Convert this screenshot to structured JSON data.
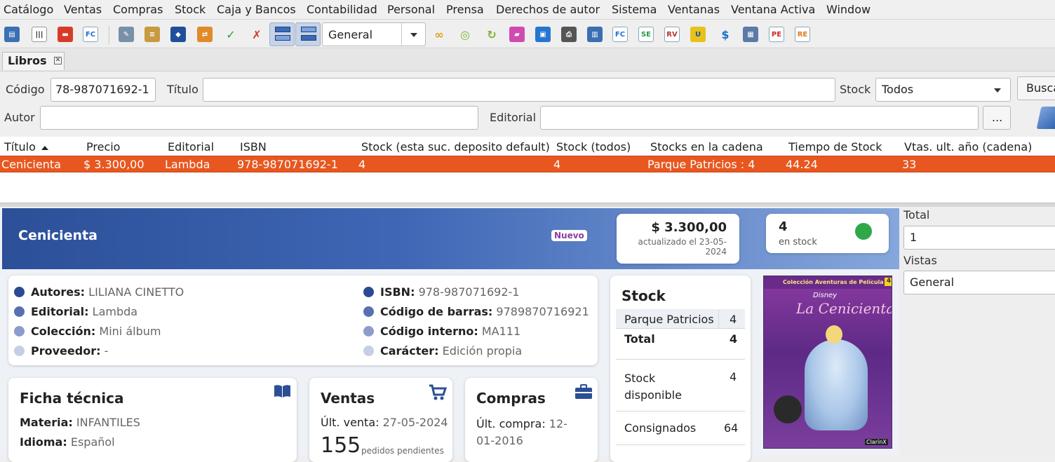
{
  "menu": [
    "Catálogo",
    "Ventas",
    "Compras",
    "Stock",
    "Caja y Bancos",
    "Contabilidad",
    "Personal",
    "Prensa",
    "Derechos de autor",
    "Sistema",
    "Ventanas",
    "Ventana Activa",
    "Window"
  ],
  "toolbar": {
    "view_select": "General"
  },
  "tab": {
    "label": "Libros"
  },
  "filters": {
    "codigo_label": "Código",
    "codigo_value": "78-987071692-1",
    "titulo_label": "Título",
    "titulo_value": "",
    "stock_label": "Stock",
    "stock_value": "Todos",
    "buscar_label": "Buscar",
    "autor_label": "Autor",
    "autor_value": "",
    "editorial_label": "Editorial",
    "editorial_value": "",
    "more_button": "..."
  },
  "table": {
    "headers": [
      "Título",
      "Precio",
      "Editorial",
      "ISBN",
      "Stock (esta suc. deposito default)",
      "Stock (todos)",
      "Stocks en la cadena",
      "Tiempo de Stock",
      "Vtas. ult. año (cadena)"
    ],
    "rows": [
      [
        "Cenicienta",
        "$ 3.300,00",
        "Lambda",
        "978-987071692-1",
        "4",
        "4",
        "Parque Patricios : 4",
        "44.24",
        "33"
      ]
    ]
  },
  "detail": {
    "title": "Cenicienta",
    "badge": "Nuevo",
    "price": "$ 3.300,00",
    "price_updated": "actualizado el 23-05-2024",
    "stock_count": "4",
    "stock_label": "en stock",
    "info_left": [
      {
        "label": "Autores:",
        "value": "LILIANA CINETTO",
        "color": "#2a4a94"
      },
      {
        "label": "Editorial:",
        "value": "Lambda",
        "color": "#5870b0"
      },
      {
        "label": "Colección:",
        "value": "Mini álbum",
        "color": "#8c9ccc"
      },
      {
        "label": "Proveedor:",
        "value": "-",
        "color": "#c6cee6"
      }
    ],
    "info_right": [
      {
        "label": "ISBN:",
        "value": "978-987071692-1",
        "color": "#2a4a94"
      },
      {
        "label": "Código de barras:",
        "value": "9789870716921",
        "color": "#5870b0"
      },
      {
        "label": "Código interno:",
        "value": "MA111",
        "color": "#8c9ccc"
      },
      {
        "label": "Carácter:",
        "value": "Edición propia",
        "color": "#c6cee6"
      }
    ],
    "ficha": {
      "title": "Ficha técnica",
      "materia_label": "Materia:",
      "materia_value": "INFANTILES",
      "idioma_label": "Idioma:",
      "idioma_value": "Español"
    },
    "ventas": {
      "title": "Ventas",
      "ult_label": "Últ. venta:",
      "ult_value": "27-05-2024",
      "pedidos_count": "155",
      "pedidos_label": "pedidos pendientes"
    },
    "compras": {
      "title": "Compras",
      "ult_label": "Últ. compra:",
      "ult_value": "12-01-2016"
    },
    "stock_card": {
      "title": "Stock",
      "branch": "Parque Patricios",
      "branch_qty": "4",
      "total_label": "Total",
      "total_qty": "4",
      "disp_label": "Stock disponible",
      "disp_qty": "4",
      "consig_label": "Consignados",
      "consig_qty": "64"
    },
    "cover": {
      "series": "Colección Aventuras de Película",
      "number": "4",
      "brand": "Disney",
      "title": "La Cenicienta",
      "publisher": "ClarínX"
    }
  },
  "right_panel": {
    "total_label": "Total",
    "total_value": "1",
    "vistas_label": "Vistas",
    "vistas_value": "General"
  },
  "colors": {
    "selection": "#e8571f",
    "hero_start": "#2c4f98",
    "stock_ok": "#2fa84a"
  }
}
